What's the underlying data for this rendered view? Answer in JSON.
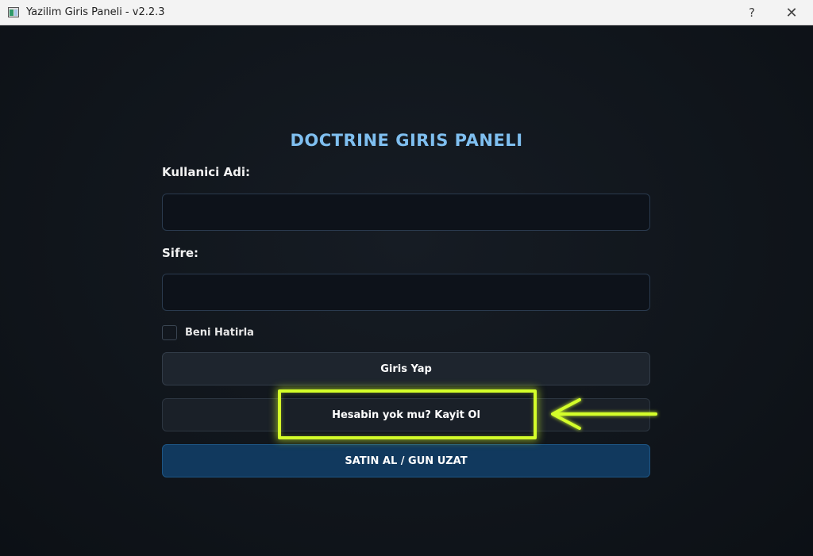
{
  "window": {
    "title": "Yazilim Giris Paneli - v2.2.3",
    "help_label": "?",
    "close_label": "✕"
  },
  "form": {
    "heading": "DOCTRINE GIRIS PANELI",
    "username_label": "Kullanici Adi:",
    "username_value": "",
    "password_label": "Sifre:",
    "password_value": "",
    "remember_label": "Beni Hatirla",
    "remember_checked": false,
    "login_button": "Giris Yap",
    "register_button": "Hesabin yok mu? Kayit Ol",
    "buy_button": "SATIN AL / GUN UZAT"
  },
  "colors": {
    "accent": "#7fbff0",
    "highlight": "#d4ff2a",
    "buy_button_bg": "#11395e"
  },
  "icons": {
    "app": "app-window-icon",
    "arrow": "left-arrow-annotation-icon"
  }
}
